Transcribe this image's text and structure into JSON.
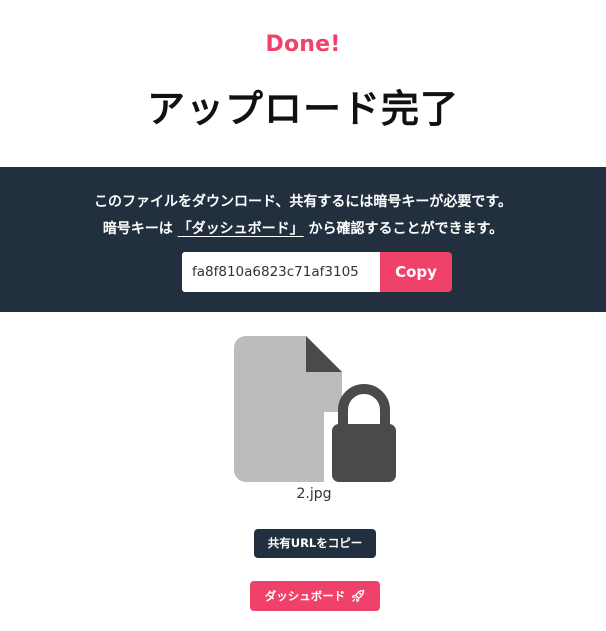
{
  "header": {
    "done_label": "Done!",
    "title": "アップロード完了"
  },
  "notice": {
    "line1": "このファイルをダウンロード、共有するには暗号キーが必要です。",
    "line2_prefix": "暗号キーは ",
    "dashboard_link": "「ダッシュボード」",
    "line2_suffix": " から確認することができます。"
  },
  "key": {
    "value": "fa8f810a6823c71af3105",
    "copy_label": "Copy"
  },
  "file": {
    "name": "2.jpg",
    "icon": "locked-file-icon"
  },
  "actions": {
    "share_url_label": "共有URLをコピー",
    "dashboard_label": "ダッシュボード",
    "dashboard_icon": "rocket-icon"
  },
  "colors": {
    "accent": "#f0416a",
    "panel": "#222f3e",
    "file_body": "#bcbcbc",
    "file_fold": "#4a4a4a",
    "lock": "#4a4a4a"
  }
}
